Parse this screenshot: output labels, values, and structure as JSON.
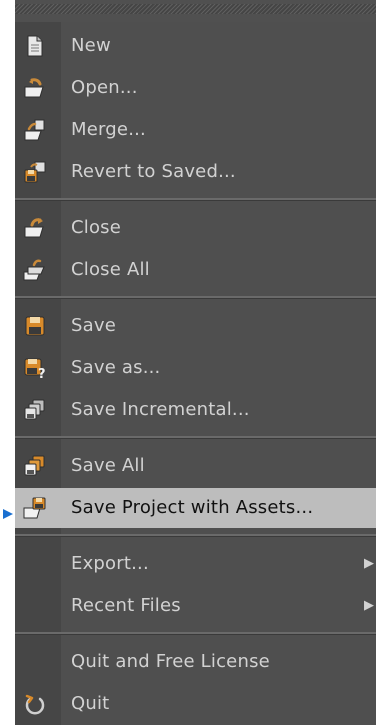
{
  "menu": {
    "items": [
      {
        "label": "New",
        "icon": "new-document-icon"
      },
      {
        "label": "Open...",
        "icon": "open-folder-icon"
      },
      {
        "label": "Merge...",
        "icon": "merge-icon"
      },
      {
        "label": "Revert to Saved...",
        "icon": "revert-icon"
      },
      {
        "label": "Close",
        "icon": "close-icon"
      },
      {
        "label": "Close All",
        "icon": "close-all-icon"
      },
      {
        "label": "Save",
        "icon": "save-icon"
      },
      {
        "label": "Save as...",
        "icon": "save-as-icon"
      },
      {
        "label": "Save Incremental...",
        "icon": "save-incremental-icon"
      },
      {
        "label": "Save All",
        "icon": "save-all-icon"
      },
      {
        "label": "Save Project with Assets...",
        "icon": "save-project-icon",
        "highlighted": true
      },
      {
        "label": "Export...",
        "submenu": true
      },
      {
        "label": "Recent Files",
        "submenu": true
      },
      {
        "label": "Quit and Free License"
      },
      {
        "label": "Quit",
        "icon": "quit-icon"
      }
    ],
    "submenu_glyph": "▶"
  },
  "colors": {
    "menu_background": "#4f4f4f",
    "gutter": "#464646",
    "text": "#d2d2d2",
    "highlight": "#bdbdbd",
    "highlight_text": "#111111",
    "pointer": "#1a6fd0"
  }
}
